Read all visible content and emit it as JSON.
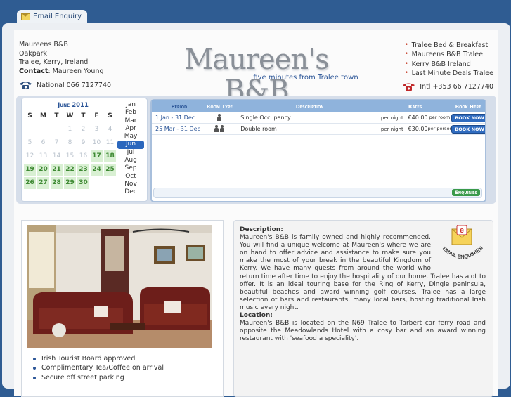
{
  "tab": {
    "label": "Email Enquiry"
  },
  "address": {
    "name": "Maureens B&B",
    "line2": "Oakpark",
    "line3": "Tralee, Kerry, Ireland",
    "contact_label": "Contact",
    "contact_value": ": Maureen Young",
    "phone_national": "National 066 7127740",
    "phone_intl": "Intl +353 66 7127740"
  },
  "logo": {
    "title": "Maureen's B&B",
    "subtitle": "five minutes from Tralee town"
  },
  "links": [
    "Tralee Bed & Breakfast",
    "Maureens B&B Tralee",
    "Kerry B&B Ireland",
    "Last Minute Deals Tralee"
  ],
  "calendar": {
    "month_label": "June 2011",
    "day_headers": [
      "S",
      "M",
      "T",
      "W",
      "T",
      "F",
      "S"
    ],
    "weeks": [
      [
        {
          "d": "",
          "s": "e"
        },
        {
          "d": "",
          "s": "e"
        },
        {
          "d": "",
          "s": "e"
        },
        {
          "d": "1",
          "s": "p"
        },
        {
          "d": "2",
          "s": "p"
        },
        {
          "d": "3",
          "s": "p"
        },
        {
          "d": "4",
          "s": "p"
        }
      ],
      [
        {
          "d": "5",
          "s": "p"
        },
        {
          "d": "6",
          "s": "p"
        },
        {
          "d": "7",
          "s": "p"
        },
        {
          "d": "8",
          "s": "p"
        },
        {
          "d": "9",
          "s": "p"
        },
        {
          "d": "10",
          "s": "p"
        },
        {
          "d": "11",
          "s": "p"
        }
      ],
      [
        {
          "d": "12",
          "s": "p"
        },
        {
          "d": "13",
          "s": "p"
        },
        {
          "d": "14",
          "s": "p"
        },
        {
          "d": "15",
          "s": "p"
        },
        {
          "d": "16",
          "s": "p"
        },
        {
          "d": "17",
          "s": "a"
        },
        {
          "d": "18",
          "s": "a"
        }
      ],
      [
        {
          "d": "19",
          "s": "a"
        },
        {
          "d": "20",
          "s": "a"
        },
        {
          "d": "21",
          "s": "a"
        },
        {
          "d": "22",
          "s": "a"
        },
        {
          "d": "23",
          "s": "a"
        },
        {
          "d": "24",
          "s": "a"
        },
        {
          "d": "25",
          "s": "a"
        }
      ],
      [
        {
          "d": "26",
          "s": "a"
        },
        {
          "d": "27",
          "s": "a"
        },
        {
          "d": "28",
          "s": "a"
        },
        {
          "d": "29",
          "s": "a"
        },
        {
          "d": "30",
          "s": "a"
        },
        {
          "d": "",
          "s": "e"
        },
        {
          "d": "",
          "s": "e"
        }
      ]
    ],
    "months": [
      "Jan",
      "Feb",
      "Mar",
      "Apr",
      "May",
      "Jun",
      "Jul",
      "Aug",
      "Sep",
      "Oct",
      "Nov",
      "Dec"
    ],
    "selected_month": "Jun"
  },
  "rates": {
    "headers": {
      "period": "Period",
      "room_type": "Room Type",
      "description": "Description",
      "rates": "Rates",
      "book": "Book Here"
    },
    "rows": [
      {
        "period": "1 Jan - 31 Dec",
        "description": "Single Occupancy",
        "per": "per night",
        "price": "€40.00",
        "per2": "per room",
        "book": "BOOK NOW",
        "persons": 1
      },
      {
        "period": "25 Mar - 31 Dec",
        "description": "Double room",
        "per": "per night",
        "price": "€30.00",
        "per2": "per person",
        "book": "BOOK NOW",
        "persons": 2
      }
    ],
    "enquiries_label": "Enquiries"
  },
  "features": [
    "Irish Tourist Board approved",
    "Complimentary Tea/Coffee on arrival",
    "Secure off street parking"
  ],
  "description": {
    "heading1": "Description:",
    "para1": "Maureen's B&B is family owned and highly recommended. You will find a unique welcome at Maureen's where we are on hand to offer advice and assistance to make sure you make the most of your break in the beautiful Kingdom of Kerry. We have many guests from around the world who return time after time to enjoy the hospitality of our home. Tralee has alot to offer. It is an ideal touring base for the Ring of Kerry, Dingle peninsula, beautiful beaches and award winning golf courses. Tralee has a large selection of bars and restaurants, many local bars, hosting traditional Irish music every night.",
    "heading2": "Location:",
    "para2": "Maureen's B&B is located on the N69 Tralee to Tarbert car ferry road and opposite the Meadowlands Hotel with a cosy bar and an award winning restaurant with 'seafood a speciality'.",
    "badge_text": "EMAIL ENQUIRIES",
    "badge_letter": "e"
  }
}
